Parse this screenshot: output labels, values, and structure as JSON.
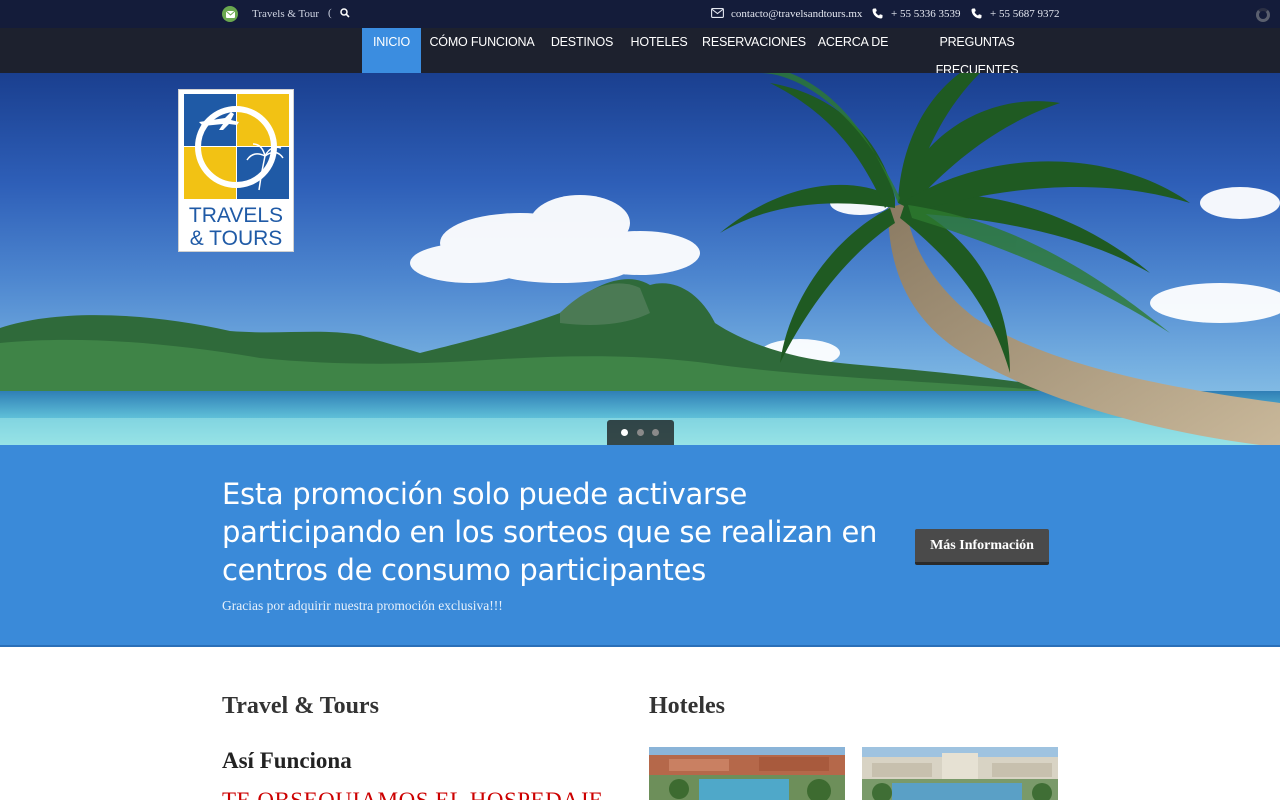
{
  "topbar": {
    "site_name": "Travels & Tour",
    "bracket": "(",
    "email": "contacto@travelsandtours.mx",
    "phone1": "+ 55 5336 3539",
    "phone2": "+ 55 5687 9372"
  },
  "nav": {
    "items": [
      "INICIO",
      "CÓMO FUNCIONA",
      "DESTINOS",
      "HOTELES",
      "RESERVACIONES",
      "ACERCA DE",
      "PREGUNTAS FRECUENTES"
    ],
    "active_index": 0
  },
  "logo": {
    "line1": "TRAVELS",
    "line2": "& TOURS"
  },
  "slider": {
    "slide_count": 3,
    "active_slide": 1
  },
  "promo": {
    "heading": "Esta promoción solo puede activarse participando en los sorteos que se realizan en centros de consumo participantes",
    "subtext": "Gracias por adquirir nuestra promoción exclusiva!!!",
    "button": "Más Información"
  },
  "content": {
    "left_title": "Travel & Tours",
    "left_subtitle": "Así Funciona",
    "left_red": "TE OBSEQUIAMOS EL HOSPEDAJE",
    "right_title": "Hoteles"
  },
  "colors": {
    "topbar_bg": "#141c3a",
    "nav_active": "#3b8de0",
    "promo_bg": "#3a8ad9",
    "button_bg": "#4a4a4a",
    "logo_yellow": "#f2c214",
    "logo_blue": "#1f5aa6",
    "red_text": "#cc0000"
  },
  "icons": {
    "mail": "mail-icon",
    "search": "search-icon",
    "envelope": "envelope-icon",
    "phone": "phone-icon",
    "loader": "loader-icon"
  }
}
